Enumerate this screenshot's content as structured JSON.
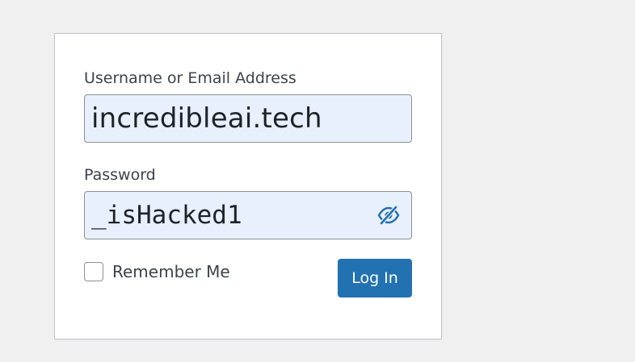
{
  "login_form": {
    "username_label": "Username or Email Address",
    "username_value": "incredibleai.tech",
    "password_label": "Password",
    "password_value": "_isHacked1",
    "remember_label": "Remember Me",
    "login_button_label": "Log In"
  },
  "icons": {
    "logo": "wordpress-logo",
    "password_toggle": "eye-slash-icon"
  },
  "colors": {
    "accent": "#2271b1",
    "background": "#f0f0f1",
    "input_fill": "#e8f0fe"
  }
}
